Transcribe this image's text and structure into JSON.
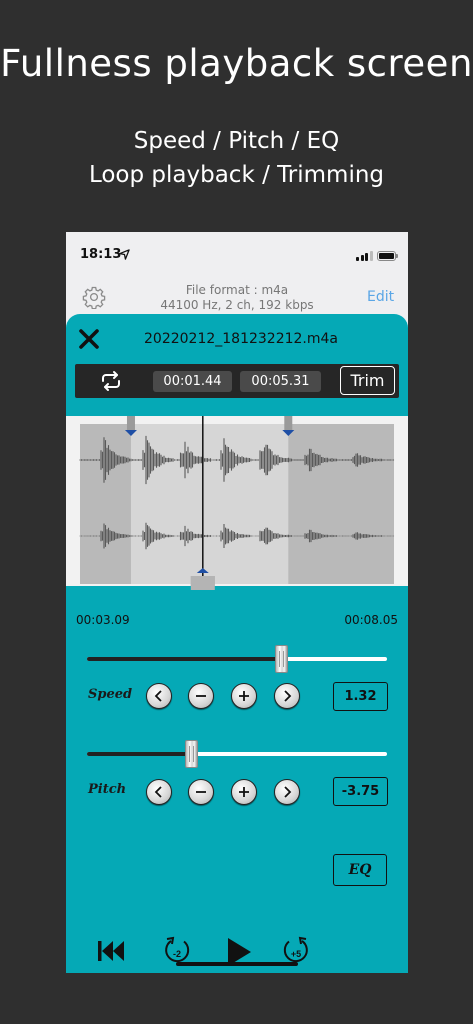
{
  "promo": {
    "headline": "Fullness playback screen",
    "line1": "Speed / Pitch / EQ",
    "line2": "Loop playback / Trimming"
  },
  "status_bar": {
    "time": "18:13"
  },
  "header": {
    "file_format": "File format : m4a",
    "audio_specs": "44100 Hz, 2 ch, 192 kbps",
    "edit_label": "Edit"
  },
  "player": {
    "file_name": "20220212_181232212.m4a",
    "loop_start": "00:01.44",
    "loop_end": "00:05.31",
    "trim_label": "Trim",
    "time_start": "00:03.09",
    "time_end": "00:08.05",
    "playhead_fraction": 0.4,
    "trim_left_fraction": 0.19,
    "trim_right_fraction": 0.65
  },
  "speed": {
    "label": "Speed",
    "value": "1.32",
    "slider_fraction": 0.65
  },
  "pitch": {
    "label": "Pitch",
    "value": "-3.75",
    "slider_fraction": 0.35
  },
  "transport": {
    "rewind_seconds": "-2",
    "forward_seconds": "+5",
    "eq_label": "EQ"
  },
  "colors": {
    "panel": "#05a9b6",
    "background": "#2f2f2f",
    "accent_link": "#5aa6e6"
  }
}
